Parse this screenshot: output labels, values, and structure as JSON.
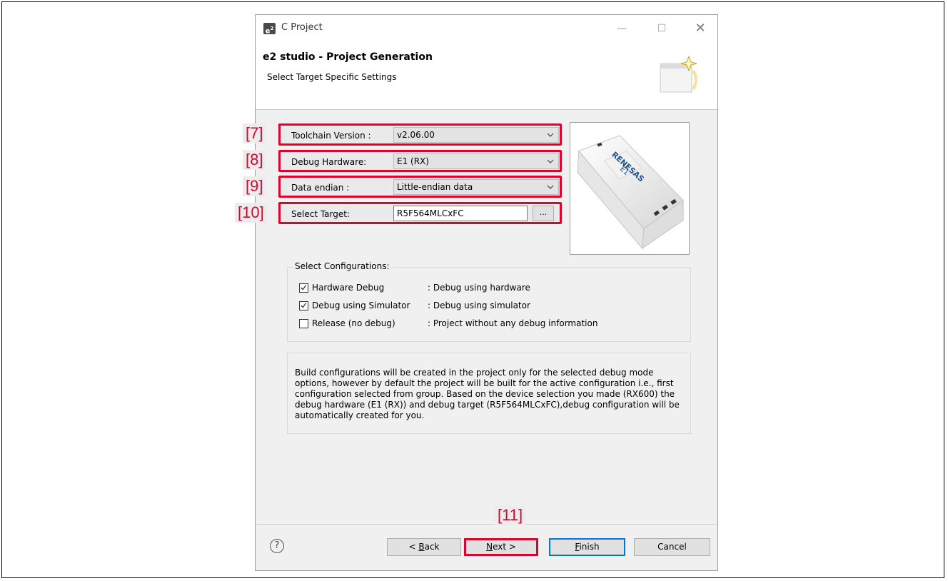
{
  "window": {
    "title": "C Project",
    "app_icon": "e2",
    "min_icon": "—",
    "max_icon": "☐",
    "close_icon": "✕"
  },
  "header": {
    "title": "e2 studio - Project Generation",
    "subtitle": "Select Target Specific Settings"
  },
  "settings": {
    "toolchain": {
      "label": "Toolchain Version :",
      "value": "v2.06.00",
      "callout": "[7]"
    },
    "debug_hw": {
      "label": "Debug Hardware:",
      "value": "E1 (RX)",
      "callout": "[8]"
    },
    "endian": {
      "label": "Data endian :",
      "value": "Little-endian data",
      "callout": "[9]"
    },
    "target": {
      "label": "Select Target:",
      "value": "R5F564MLCxFC",
      "browse": "...",
      "callout": "[10]"
    }
  },
  "device_image": {
    "text1": "RENESAS",
    "text2": "E1"
  },
  "configurations": {
    "title": "Select Configurations:",
    "items": [
      {
        "name": "Hardware Debug",
        "desc": ": Debug using hardware",
        "checked": true
      },
      {
        "name": "Debug using Simulator",
        "desc": ": Debug using simulator",
        "checked": true
      },
      {
        "name": "Release (no debug)",
        "desc": ": Project without any debug information",
        "checked": false
      }
    ]
  },
  "info": "Build configurations will be created in the project only for the selected debug mode options, however by default the project will be built for the active configuration i.e., first configuration selected from group. Based on the device selection you made (RX600) the debug hardware (E1 (RX)) and debug target (R5F564MLCxFC),debug configuration will be automatically created for you.",
  "footer": {
    "help": "?",
    "back_key": "B",
    "back_rest": "ack",
    "back_prefix": "< ",
    "next_key": "N",
    "next_rest": "ext >",
    "finish_key": "F",
    "finish_rest": "inish",
    "cancel": "Cancel",
    "callout": "[11]"
  }
}
